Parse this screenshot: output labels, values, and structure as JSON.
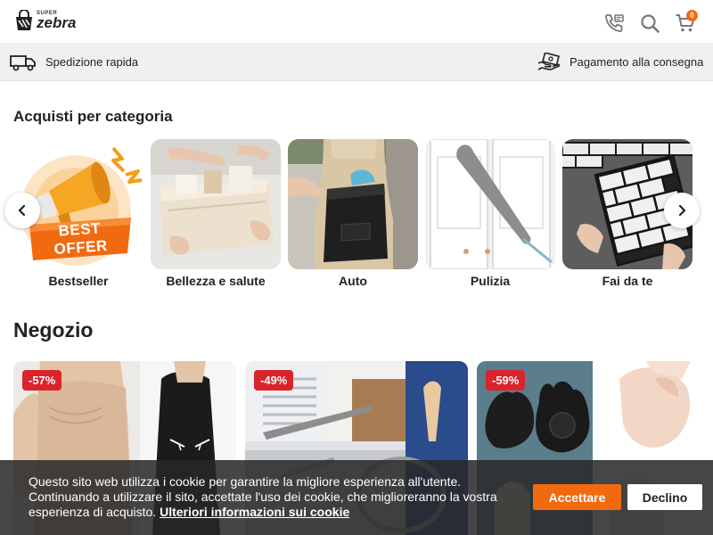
{
  "header": {
    "logo": {
      "super": "SUPER",
      "main": "zebra"
    },
    "icons": [
      "phone-icon",
      "search-icon",
      "cart-icon"
    ],
    "cart_count": "0"
  },
  "infobar": {
    "shipping": "Spedizione rapida",
    "payment": "Pagamento alla consegna"
  },
  "categories": {
    "title": "Acquisti per categoria",
    "items": [
      {
        "label": "Bestseller",
        "badge": "BEST OFFER"
      },
      {
        "label": "Bellezza e salute"
      },
      {
        "label": "Auto"
      },
      {
        "label": "Pulizia"
      },
      {
        "label": "Fai da te"
      }
    ]
  },
  "shop": {
    "title": "Negozio",
    "products": [
      {
        "discount": "-57%"
      },
      {
        "discount": "-49%"
      },
      {
        "discount": "-59%"
      }
    ]
  },
  "cookie": {
    "line1": "Questo sito web utilizza i cookie per garantire la migliore esperienza all'utente.",
    "line2": "Continuando a utilizzare il sito, accettate l'uso dei cookie, che miglioreranno la vostra",
    "line3": "esperienza di acquisto.",
    "link": "Ulteriori informazioni sui cookie",
    "accept": "Accettare",
    "decline": "Declino"
  },
  "colors": {
    "accent": "#f26a10",
    "discount": "#d9232d",
    "infobar_bg": "#f0f0f0"
  }
}
